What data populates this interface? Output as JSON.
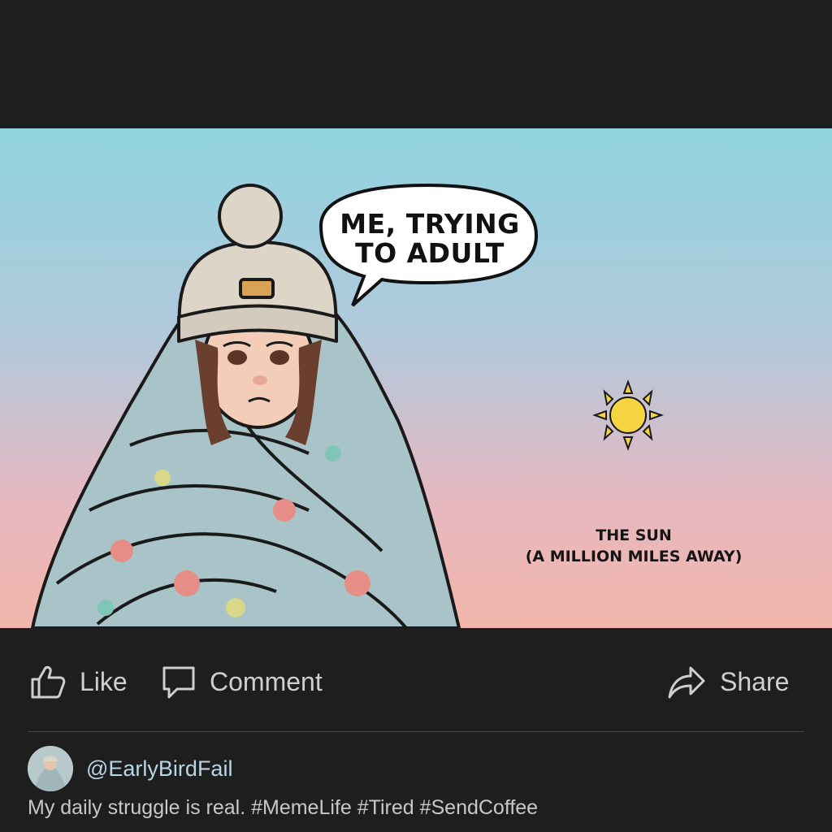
{
  "post": {
    "image": {
      "speech_bubble": "ME, TRYING TO ADULT",
      "sun_label_line1": "THE SUN",
      "sun_label_line2": "(A MILLION MILES AWAY)"
    },
    "actions": {
      "like_label": "Like",
      "comment_label": "Comment",
      "share_label": "Share",
      "icons": [
        "thumbs-up-icon",
        "comment-icon",
        "share-icon"
      ]
    },
    "author": {
      "username": "@EarlyBirdFail"
    },
    "caption": "My daily struggle is real. #MemeLife #Tired #SendCoffee"
  },
  "colors": {
    "background": "#1e1e1e",
    "sky_top": "#8fd3df",
    "sky_bottom": "#f2b6aa",
    "sun": "#f5d442",
    "username": "#b7d6e6"
  }
}
